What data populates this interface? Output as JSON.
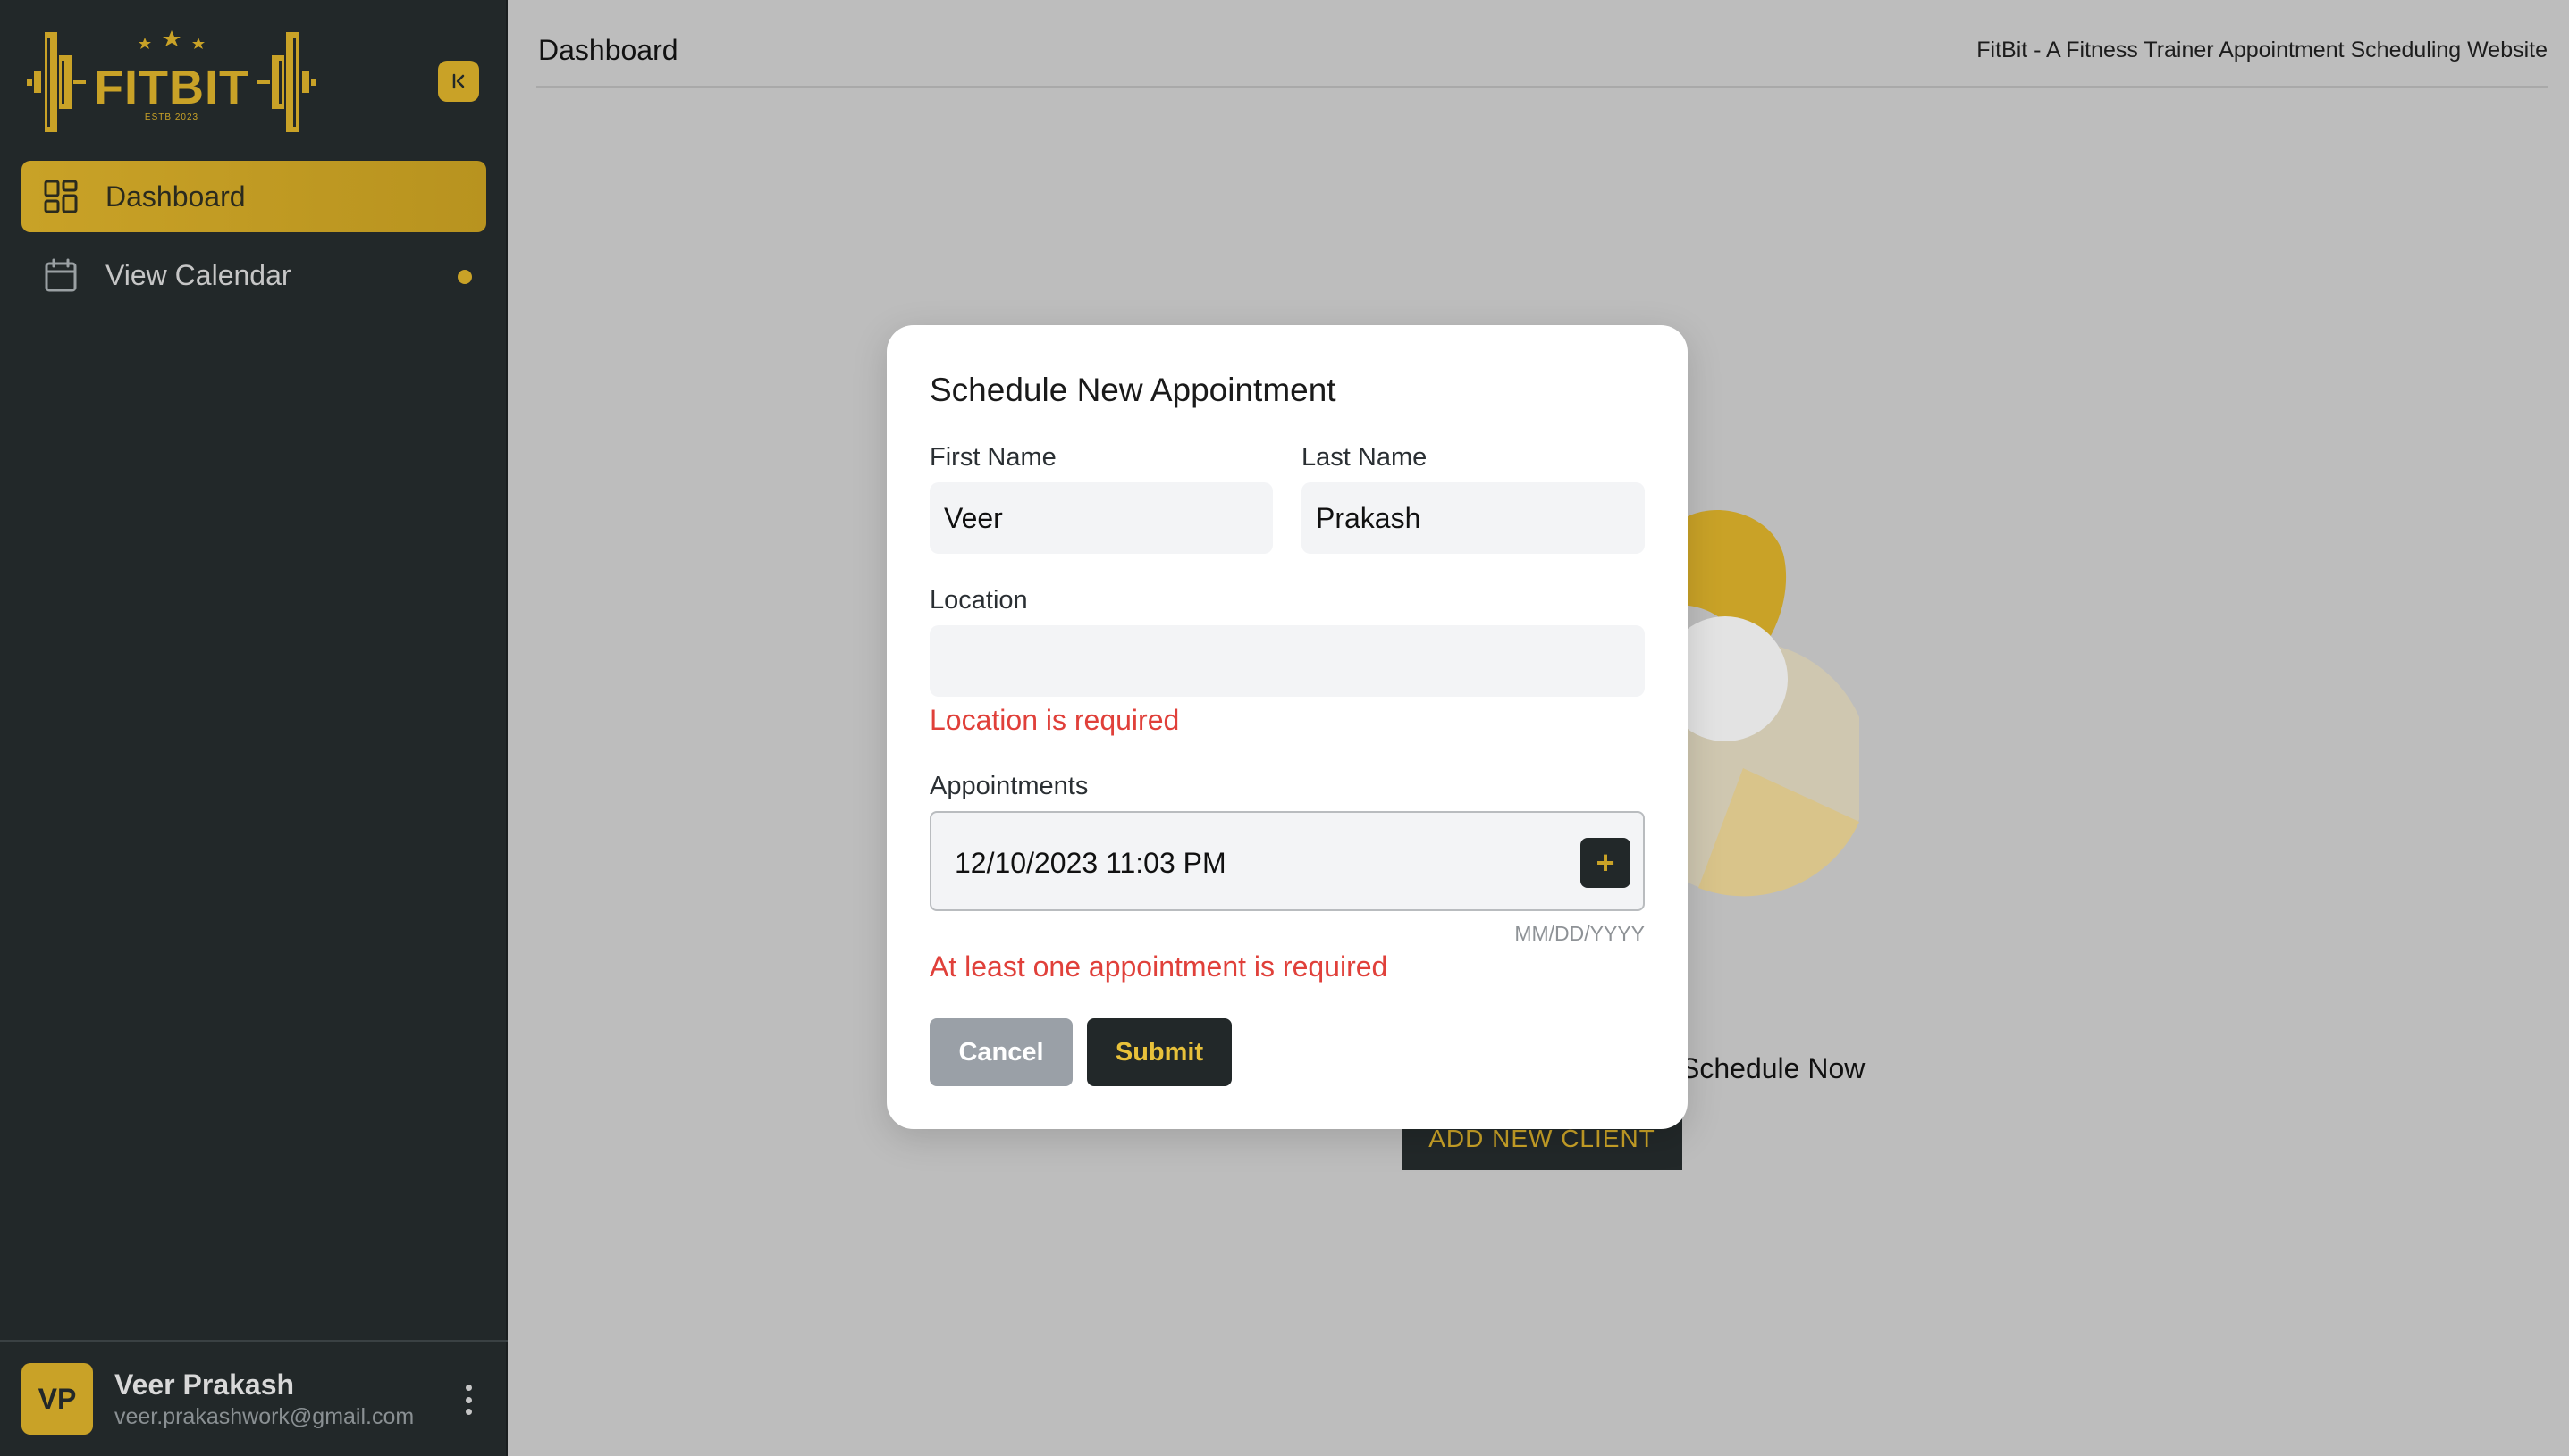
{
  "app": {
    "brand": {
      "name": "FITBIT",
      "tagline": "ESTB 2023"
    },
    "accent_color": "#c9a227",
    "sidebar_bg": "#222829"
  },
  "sidebar": {
    "collapse_icon": "collapse-left-icon",
    "items": [
      {
        "label": "Dashboard",
        "icon": "grid-icon",
        "active": true
      },
      {
        "label": "View Calendar",
        "icon": "calendar-icon",
        "active": false,
        "has_notification_dot": true
      }
    ],
    "user": {
      "initials": "VP",
      "name": "Veer Prakash",
      "email": "veer.prakashwork@gmail.com"
    }
  },
  "header": {
    "page_title": "Dashboard",
    "site_title": "FitBit - A Fitness Trainer Appointment Scheduling Website"
  },
  "background": {
    "cta_text": "Schedule Now",
    "add_client_label": "ADD NEW CLIENT"
  },
  "modal": {
    "title": "Schedule New Appointment",
    "first_name": {
      "label": "First Name",
      "value": "Veer"
    },
    "last_name": {
      "label": "Last Name",
      "value": "Prakash"
    },
    "location": {
      "label": "Location",
      "value": "",
      "error": "Location is required"
    },
    "appointments": {
      "label": "Appointments",
      "value": "12/10/2023 11:03 PM",
      "add_label": "+",
      "hint": "MM/DD/YYYY",
      "error": "At least one appointment is required"
    },
    "cancel_label": "Cancel",
    "submit_label": "Submit"
  }
}
